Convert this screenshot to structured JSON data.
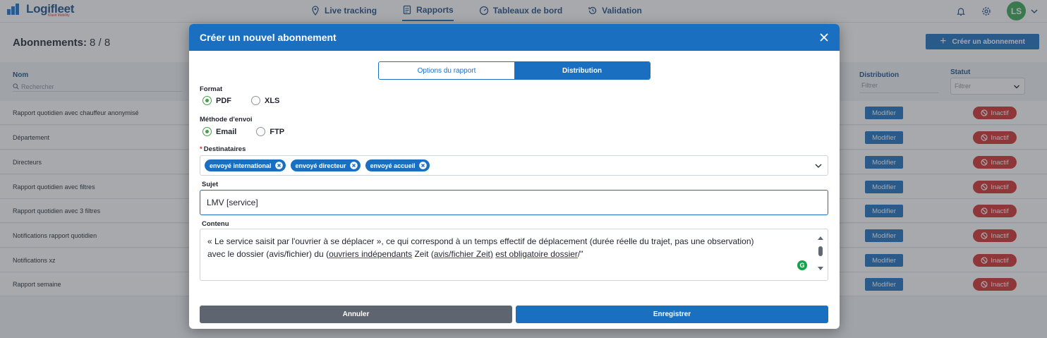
{
  "app": {
    "name": "Logifleet",
    "subname": "Klaxit Mobility",
    "nav": [
      {
        "label": "Live tracking",
        "icon": "location-pin-icon"
      },
      {
        "label": "Rapports",
        "icon": "report-icon",
        "active": true
      },
      {
        "label": "Tableaux de bord",
        "icon": "dashboard-icon"
      },
      {
        "label": "Validation",
        "icon": "validation-icon"
      }
    ],
    "user_initials": "LS"
  },
  "page": {
    "title": "Abonnements:",
    "count": "8 / 8",
    "create_label": "Créer un abonnement",
    "columns": {
      "name": "Nom",
      "distribution": "Distribution",
      "status": "Statut"
    },
    "search_placeholder": "Rechercher",
    "filter_placeholder": "Filtrer",
    "rows": [
      {
        "name": "Rapport quotidien avec chauffeur anonymisé",
        "action": "Modifier",
        "status": "Inactif"
      },
      {
        "name": "Département",
        "action": "Modifier",
        "status": "Inactif"
      },
      {
        "name": "Directeurs",
        "action": "Modifier",
        "status": "Inactif"
      },
      {
        "name": "Rapport quotidien avec filtres",
        "action": "Modifier",
        "status": "Inactif"
      },
      {
        "name": "Rapport quotidien avec 3 filtres",
        "action": "Modifier",
        "status": "Inactif"
      },
      {
        "name": "Notifications rapport quotidien",
        "action": "Modifier",
        "status": "Inactif"
      },
      {
        "name": "Notifications xz",
        "action": "Modifier",
        "status": "Inactif"
      },
      {
        "name": "Rapport semaine",
        "action": "Modifier",
        "status": "Inactif"
      }
    ]
  },
  "modal": {
    "title": "Créer un nouvel abonnement",
    "tabs": [
      {
        "label": "Options du rapport",
        "active": false
      },
      {
        "label": "Distribution",
        "active": true
      }
    ],
    "format": {
      "label": "Format",
      "options": [
        "PDF",
        "XLS"
      ],
      "selected": "PDF"
    },
    "method": {
      "label": "Méthode d'envoi",
      "options": [
        "Email",
        "FTP"
      ],
      "selected": "Email"
    },
    "recipients": {
      "required_mark": "*",
      "label": "Destinataires",
      "chips": [
        "envoyé international",
        "envoyé directeur",
        "envoyé accueil"
      ]
    },
    "subject": {
      "label": "Sujet",
      "value": "LMV [service]"
    },
    "content": {
      "label": "Contenu",
      "line1": "« Le service saisit par l'ouvrier à se déplacer », ce qui correspond à un temps effectif de déplacement (durée réelle du trajet, pas une observation)",
      "line2_a": "avec le dossier (avis/fichier) du (",
      "line2_b": "ouvriers indépendants",
      "line2_c": " Zeit (",
      "line2_d": "avis/fichier Zeit)",
      "line2_e": " ",
      "line2_f": "est obligatoire dossier",
      "line2_g": "/\""
    },
    "cancel_label": "Annuler",
    "save_label": "Enregistrer"
  },
  "colors": {
    "primary": "#1b6fc0",
    "danger": "#d32f2f",
    "success": "#43a047",
    "cancel": "#5f6570"
  }
}
